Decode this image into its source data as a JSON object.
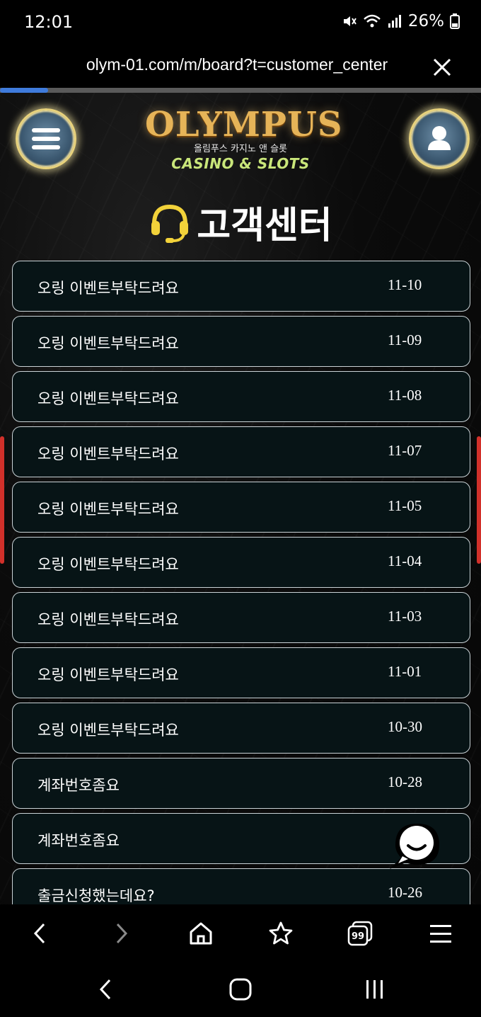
{
  "status_bar": {
    "time": "12:01",
    "battery": "26%"
  },
  "browser": {
    "url": "olym-01.com/m/board?t=customer_center",
    "load_progress": 0.1
  },
  "header": {
    "logo_main": "OLYMPUS",
    "logo_sub": "올림푸스 카지노 앤 슬롯",
    "logo_tagline": "CASINO & SLOTS",
    "menu_icon": "hamburger-menu-icon",
    "profile_icon": "user-icon"
  },
  "page": {
    "title": "고객센터",
    "title_icon": "headset-icon"
  },
  "posts": [
    {
      "title": "오링 이벤트부탁드려요",
      "date": "11-10"
    },
    {
      "title": "오링 이벤트부탁드려요",
      "date": "11-09"
    },
    {
      "title": "오링 이벤트부탁드려요",
      "date": "11-08"
    },
    {
      "title": "오링 이벤트부탁드려요",
      "date": "11-07"
    },
    {
      "title": "오링 이벤트부탁드려요",
      "date": "11-05"
    },
    {
      "title": "오링 이벤트부탁드려요",
      "date": "11-04"
    },
    {
      "title": "오링 이벤트부탁드려요",
      "date": "11-03"
    },
    {
      "title": "오링 이벤트부탁드려요",
      "date": "11-01"
    },
    {
      "title": "오링 이벤트부탁드려요",
      "date": "10-30"
    },
    {
      "title": "계좌번호좀요",
      "date": "10-28"
    },
    {
      "title": "계좌번호좀요",
      "date": ""
    },
    {
      "title": "출금신청했는데요?",
      "date": "10-26"
    }
  ],
  "colors": {
    "row_border": "#c9d2d6",
    "row_bg": "#071416",
    "accent_gold": "#e6b458",
    "headset_yellow": "#f2d23a",
    "progress_blue": "#3f7bdc",
    "edge_red": "#d2302a"
  },
  "browser_toolbar": {
    "tabs_count": "99",
    "icons": [
      "back-icon",
      "forward-icon",
      "home-icon",
      "bookmark-star-icon",
      "tabs-icon",
      "menu-icon"
    ]
  },
  "nav_bar": {
    "icons": [
      "nav-back-icon",
      "nav-home-icon",
      "nav-recents-icon"
    ]
  }
}
